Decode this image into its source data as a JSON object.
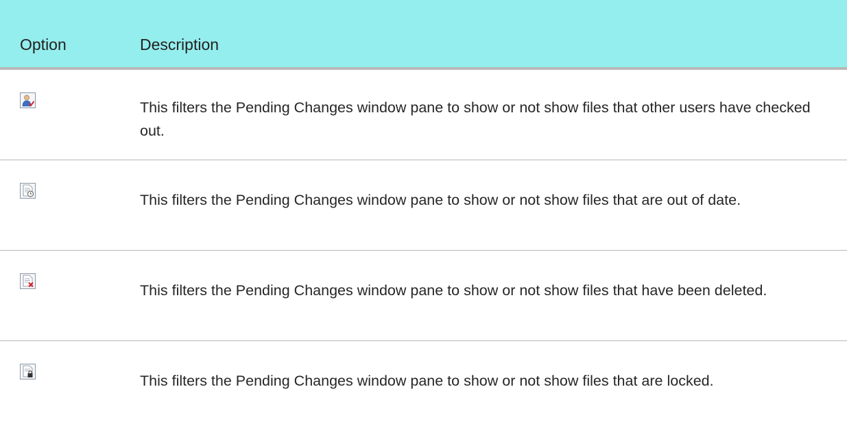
{
  "table": {
    "headers": {
      "option": "Option",
      "description": "Description"
    },
    "rows": [
      {
        "icon": "user-checked-out-icon",
        "description": "This filters the Pending Changes window pane to show or not show files that other users have checked out."
      },
      {
        "icon": "document-clock-icon",
        "description": "This filters the Pending Changes window pane to show or not show files that are out of date."
      },
      {
        "icon": "document-delete-icon",
        "description": "This filters the Pending Changes window pane to show or not show files that have been deleted."
      },
      {
        "icon": "document-lock-icon",
        "description": "This filters the Pending Changes window pane to show or not show files that are locked."
      }
    ]
  },
  "colors": {
    "header_background": "#94eeed",
    "divider": "#b8b8b8"
  }
}
